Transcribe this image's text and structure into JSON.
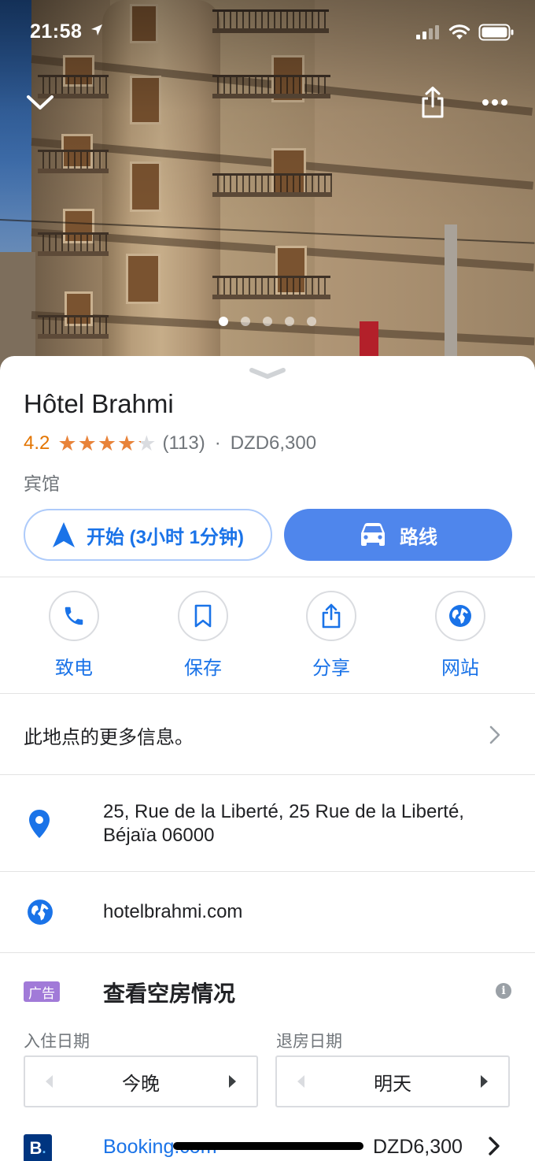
{
  "status_bar": {
    "time": "21:58"
  },
  "hero": {
    "photo_count": 5,
    "active_photo": 1,
    "icons": [
      "chevron-down-icon",
      "share-icon",
      "more-icon"
    ]
  },
  "place": {
    "name": "Hôtel Brahmi",
    "rating": "4.2",
    "stars_filled": 4.2,
    "review_count": "(113)",
    "separator": "·",
    "price": "DZD6,300",
    "category": "宾馆"
  },
  "buttons": {
    "start_label": "开始 (3小时 1分钟)",
    "route_label": "路线"
  },
  "actions": [
    {
      "label": "致电",
      "icon": "phone-icon"
    },
    {
      "label": "保存",
      "icon": "bookmark-icon"
    },
    {
      "label": "分享",
      "icon": "share-icon"
    },
    {
      "label": "网站",
      "icon": "globe-icon"
    }
  ],
  "more_info": {
    "label": "此地点的更多信息。"
  },
  "address": {
    "line1": "25, Rue de la Liberté, 25 Rue de la Liberté,",
    "line2": "Béjaïa 06000"
  },
  "website": {
    "url": "hotelbrahmi.com"
  },
  "availability": {
    "ad_badge": "广告",
    "title": "查看空房情况",
    "checkin_label": "入住日期",
    "checkin_value": "今晚",
    "checkout_label": "退房日期",
    "checkout_value": "明天"
  },
  "booking": {
    "logo": "B",
    "provider": "Booking.com",
    "price": "DZD6,300"
  },
  "colors": {
    "accent": "#1a73e8",
    "route_button": "#4f86ec",
    "rating": "#e37400",
    "star": "#e8833a",
    "ad": "#a17ad8"
  }
}
